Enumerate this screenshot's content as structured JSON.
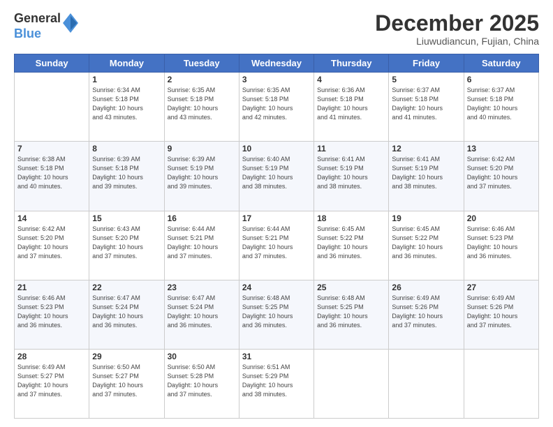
{
  "logo": {
    "general": "General",
    "blue": "Blue"
  },
  "header": {
    "month": "December 2025",
    "location": "Liuwudiancun, Fujian, China"
  },
  "weekdays": [
    "Sunday",
    "Monday",
    "Tuesday",
    "Wednesday",
    "Thursday",
    "Friday",
    "Saturday"
  ],
  "weeks": [
    [
      {
        "day": "",
        "info": ""
      },
      {
        "day": "1",
        "info": "Sunrise: 6:34 AM\nSunset: 5:18 PM\nDaylight: 10 hours\nand 43 minutes."
      },
      {
        "day": "2",
        "info": "Sunrise: 6:35 AM\nSunset: 5:18 PM\nDaylight: 10 hours\nand 43 minutes."
      },
      {
        "day": "3",
        "info": "Sunrise: 6:35 AM\nSunset: 5:18 PM\nDaylight: 10 hours\nand 42 minutes."
      },
      {
        "day": "4",
        "info": "Sunrise: 6:36 AM\nSunset: 5:18 PM\nDaylight: 10 hours\nand 41 minutes."
      },
      {
        "day": "5",
        "info": "Sunrise: 6:37 AM\nSunset: 5:18 PM\nDaylight: 10 hours\nand 41 minutes."
      },
      {
        "day": "6",
        "info": "Sunrise: 6:37 AM\nSunset: 5:18 PM\nDaylight: 10 hours\nand 40 minutes."
      }
    ],
    [
      {
        "day": "7",
        "info": "Sunrise: 6:38 AM\nSunset: 5:18 PM\nDaylight: 10 hours\nand 40 minutes."
      },
      {
        "day": "8",
        "info": "Sunrise: 6:39 AM\nSunset: 5:18 PM\nDaylight: 10 hours\nand 39 minutes."
      },
      {
        "day": "9",
        "info": "Sunrise: 6:39 AM\nSunset: 5:19 PM\nDaylight: 10 hours\nand 39 minutes."
      },
      {
        "day": "10",
        "info": "Sunrise: 6:40 AM\nSunset: 5:19 PM\nDaylight: 10 hours\nand 38 minutes."
      },
      {
        "day": "11",
        "info": "Sunrise: 6:41 AM\nSunset: 5:19 PM\nDaylight: 10 hours\nand 38 minutes."
      },
      {
        "day": "12",
        "info": "Sunrise: 6:41 AM\nSunset: 5:19 PM\nDaylight: 10 hours\nand 38 minutes."
      },
      {
        "day": "13",
        "info": "Sunrise: 6:42 AM\nSunset: 5:20 PM\nDaylight: 10 hours\nand 37 minutes."
      }
    ],
    [
      {
        "day": "14",
        "info": "Sunrise: 6:42 AM\nSunset: 5:20 PM\nDaylight: 10 hours\nand 37 minutes."
      },
      {
        "day": "15",
        "info": "Sunrise: 6:43 AM\nSunset: 5:20 PM\nDaylight: 10 hours\nand 37 minutes."
      },
      {
        "day": "16",
        "info": "Sunrise: 6:44 AM\nSunset: 5:21 PM\nDaylight: 10 hours\nand 37 minutes."
      },
      {
        "day": "17",
        "info": "Sunrise: 6:44 AM\nSunset: 5:21 PM\nDaylight: 10 hours\nand 37 minutes."
      },
      {
        "day": "18",
        "info": "Sunrise: 6:45 AM\nSunset: 5:22 PM\nDaylight: 10 hours\nand 36 minutes."
      },
      {
        "day": "19",
        "info": "Sunrise: 6:45 AM\nSunset: 5:22 PM\nDaylight: 10 hours\nand 36 minutes."
      },
      {
        "day": "20",
        "info": "Sunrise: 6:46 AM\nSunset: 5:23 PM\nDaylight: 10 hours\nand 36 minutes."
      }
    ],
    [
      {
        "day": "21",
        "info": "Sunrise: 6:46 AM\nSunset: 5:23 PM\nDaylight: 10 hours\nand 36 minutes."
      },
      {
        "day": "22",
        "info": "Sunrise: 6:47 AM\nSunset: 5:24 PM\nDaylight: 10 hours\nand 36 minutes."
      },
      {
        "day": "23",
        "info": "Sunrise: 6:47 AM\nSunset: 5:24 PM\nDaylight: 10 hours\nand 36 minutes."
      },
      {
        "day": "24",
        "info": "Sunrise: 6:48 AM\nSunset: 5:25 PM\nDaylight: 10 hours\nand 36 minutes."
      },
      {
        "day": "25",
        "info": "Sunrise: 6:48 AM\nSunset: 5:25 PM\nDaylight: 10 hours\nand 36 minutes."
      },
      {
        "day": "26",
        "info": "Sunrise: 6:49 AM\nSunset: 5:26 PM\nDaylight: 10 hours\nand 37 minutes."
      },
      {
        "day": "27",
        "info": "Sunrise: 6:49 AM\nSunset: 5:26 PM\nDaylight: 10 hours\nand 37 minutes."
      }
    ],
    [
      {
        "day": "28",
        "info": "Sunrise: 6:49 AM\nSunset: 5:27 PM\nDaylight: 10 hours\nand 37 minutes."
      },
      {
        "day": "29",
        "info": "Sunrise: 6:50 AM\nSunset: 5:27 PM\nDaylight: 10 hours\nand 37 minutes."
      },
      {
        "day": "30",
        "info": "Sunrise: 6:50 AM\nSunset: 5:28 PM\nDaylight: 10 hours\nand 37 minutes."
      },
      {
        "day": "31",
        "info": "Sunrise: 6:51 AM\nSunset: 5:29 PM\nDaylight: 10 hours\nand 38 minutes."
      },
      {
        "day": "",
        "info": ""
      },
      {
        "day": "",
        "info": ""
      },
      {
        "day": "",
        "info": ""
      }
    ]
  ]
}
